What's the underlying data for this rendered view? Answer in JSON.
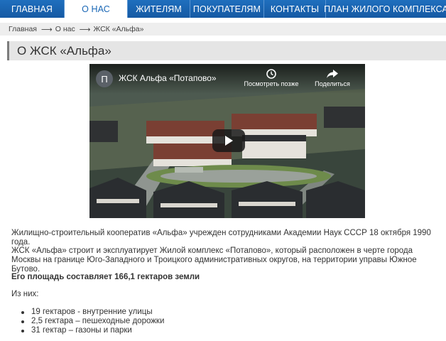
{
  "nav": {
    "items": [
      {
        "label": "ГЛАВНАЯ",
        "active": false
      },
      {
        "label": "О НАС",
        "active": true
      },
      {
        "label": "ЖИТЕЛЯМ",
        "active": false
      },
      {
        "label": "ПОКУПАТЕЛЯМ",
        "active": false
      },
      {
        "label": "КОНТАКТЫ",
        "active": false
      },
      {
        "label": "ПЛАН ЖИЛОГО КОМПЛЕКСА",
        "active": false
      }
    ]
  },
  "breadcrumb": {
    "home": "Главная",
    "about": "О нас",
    "current": "ЖСК «Альфа»",
    "separator": "⟶"
  },
  "page": {
    "title": "О ЖСК «Альфа»"
  },
  "video": {
    "channel_letter": "П",
    "title": "ЖСК Альфа «Потапово»",
    "watch_later": "Посмотреть позже",
    "share": "Поделиться"
  },
  "content": {
    "p1": "Жилищно-строительный кооператив «Альфа» учрежден сотрудниками Академии Наук СССР 18 октября 1990 года.",
    "p2": "ЖСК «Альфа» строит и эксплуатирует Жилой комплекс «Потапово», который расположен в черте города Москвы на границе Юго-Западного и Троицкого административных округов, на территории управы Южное Бутово.",
    "p3": "Его площадь составляет 166,1 гектаров земли",
    "p4": "Из них:",
    "list": [
      "19 гектаров - внутренние улицы",
      "2,5 гектара – пешеходные дорожки",
      "31 гектар – газоны и парки"
    ]
  },
  "colors": {
    "nav": "#1a64b0",
    "active_text": "#1a67b5"
  }
}
